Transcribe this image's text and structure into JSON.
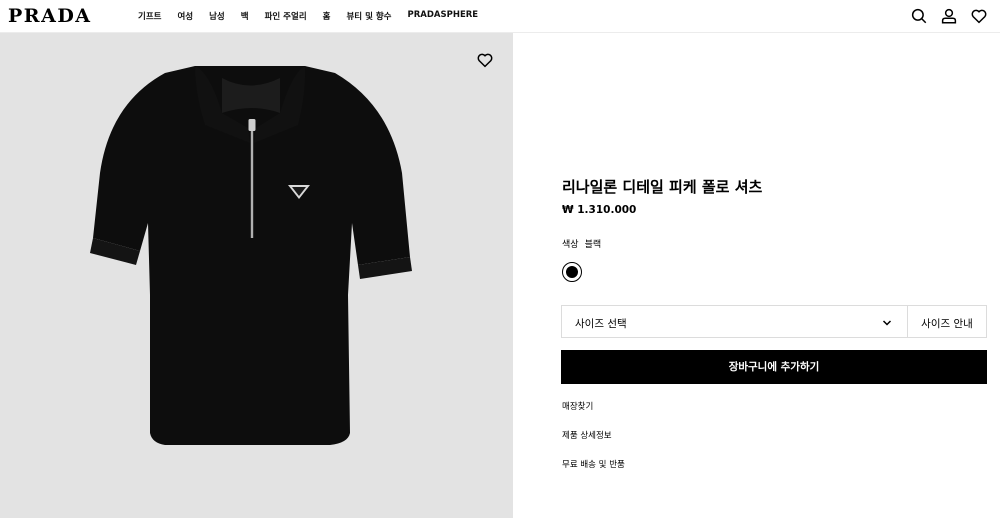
{
  "header": {
    "logo": "PRADA",
    "nav": [
      "기프트",
      "여성",
      "남성",
      "백",
      "파인 주얼리",
      "홈",
      "뷰티 및 향수",
      "PRADASPHERE"
    ],
    "icons": [
      "search-icon",
      "account-icon",
      "wishlist-icon"
    ]
  },
  "product": {
    "title": "리나일론 디테일 피케 폴로 셔츠",
    "price": "₩ 1.310.000",
    "color_label": "색상",
    "color_value": "블랙",
    "swatch_color": "#000000",
    "size_placeholder": "사이즈 선택",
    "size_guide": "사이즈 안내",
    "add_to_cart": "장바구니에 추가하기",
    "links": [
      "매장찾기",
      "제품 상세정보",
      "무료 배송 및 반품"
    ]
  },
  "image": {
    "background": "#e3e3e3",
    "icon": "heart-icon"
  }
}
